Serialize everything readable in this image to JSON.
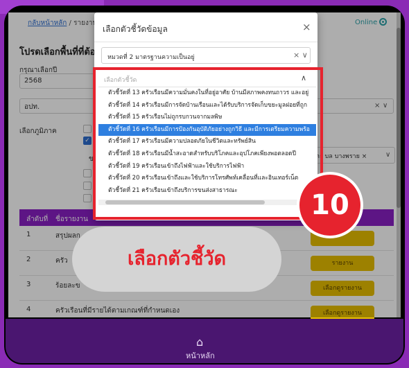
{
  "app": {
    "breadcrumb": {
      "home": "กลับหน้าหลัก",
      "separator": "/",
      "current": "รายงาน"
    },
    "status": "Online",
    "page_title": "โปรดเลือกพื้นที่ที่ต้อง",
    "year": {
      "label": "กรุณาเลือกปี",
      "value": "2568"
    },
    "area": {
      "value": "อปท.",
      "clear": "×",
      "chevron": "∨"
    },
    "filter_label": "เลือกภูมิภาค",
    "checkbox_letters": "ข",
    "right_select": {
      "value": "ตะ บล บางพราย",
      "clear": "×",
      "chevron": "∨"
    },
    "table": {
      "headers": [
        "ลำดับที่",
        "ชื่อรายงาน"
      ],
      "rows": [
        {
          "no": "1",
          "name": "สรุปผลก",
          "button": ""
        },
        {
          "no": "2",
          "name": "ครัว",
          "button": "รายงาน"
        },
        {
          "no": "3",
          "name": "ร้อยละข",
          "button": "เลือกดูรายงาน"
        },
        {
          "no": "4",
          "name": "ครัวเรือนที่มีรายได้ตามเกณฑ์ที่กำหนดเอง",
          "button": "เลือกดูรายงาน"
        }
      ]
    }
  },
  "modal": {
    "title": "เลือกตัวชี้วัดข้อมูล",
    "close": "×",
    "standard_select": {
      "value": "หมวดที่ 2 มาตรฐานความเป็นอยู่",
      "controls": "× ∨"
    },
    "indicator_select": {
      "placeholder": "เลือกตัวชี้วัด",
      "chevron": "∧",
      "options": [
        "ตัวชี้วัดที่ 13 ครัวเรือนมีความมั่นคงในที่อยู่อาศัย บ้านมีสภาพคงทนถาวร และอยู่",
        "ตัวชี้วัดที่ 14 ครัวเรือนมีการจัดบ้านเรือนและได้รับบริการจัดเก็บขยะมูลฝอยที่ถูก",
        "ตัวชี้วัดที่ 15 ครัวเรือนไม่ถูกรบกวนจากมลพิษ",
        "ตัวชี้วัดที่ 16 ครัวเรือนมีการป้องกันอุบัติภัยอย่างถูกวิธี และมีการเตรียมความพร้อ",
        "ตัวชี้วัดที่ 17 ครัวเรือนมีความปลอดภัยในชีวิตและทรัพย์สิน",
        "ตัวชี้วัดที่ 18 ครัวเรือนมีน้ำสะอาดสำหรับบริโภคและอุปโภคเพียงพอตลอดปี",
        "ตัวชี้วัดที่ 19 ครัวเรือนเข้าถึงไฟฟ้าและใช้บริการไฟฟ้า",
        "ตัวชี้วัดที่ 20 ครัวเรือนเข้าถึงและใช้บริการโทรศัพท์เคลื่อนที่และอินเทอร์เน็ต",
        "ตัวชี้วัดที่ 21 ครัวเรือนเข้าถึงบริการขนส่งสาธารณะ"
      ],
      "selected_index": 3
    }
  },
  "overlay": {
    "step_number": "10",
    "callout": "เลือกตัวชี้วัด",
    "highlight_color": "#e6232e"
  },
  "footer": {
    "home_label": "หน้าหลัก",
    "home_icon": "home-icon"
  },
  "colors": {
    "purple": "#8a1fc4",
    "selected_blue": "#2e7fe0",
    "report_yellow": "#e8bf00"
  }
}
